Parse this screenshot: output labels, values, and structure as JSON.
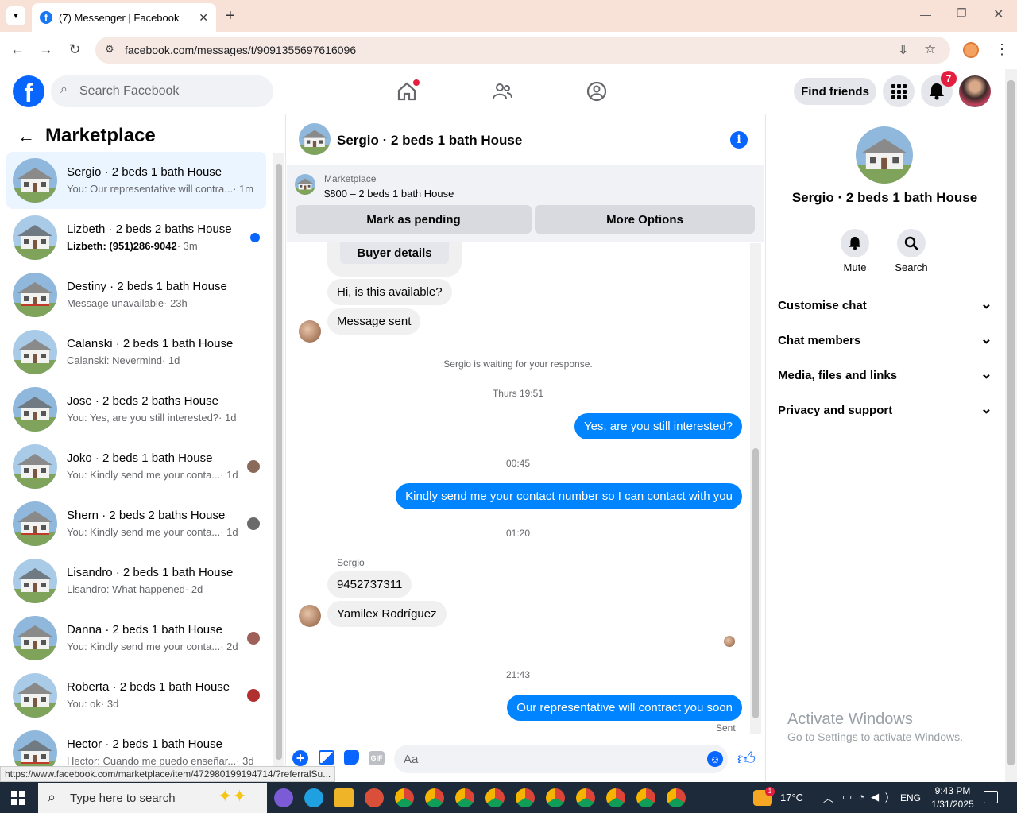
{
  "browser": {
    "tab_title": "(7) Messenger | Facebook",
    "url": "facebook.com/messages/t/9091355697616096"
  },
  "header": {
    "search_placeholder": "Search Facebook",
    "find_friends": "Find friends",
    "notif_count": "7"
  },
  "sidebar": {
    "title": "Marketplace",
    "conversations": [
      {
        "name": "Sergio · 2 beds 1 bath House",
        "preview": "You: Our representative will contra...",
        "time": "· 1m",
        "selected": true
      },
      {
        "name": "Lizbeth · 2 beds 2 baths House",
        "preview": "Lizbeth: (951)286-9042",
        "time": "· 3m",
        "unread": true
      },
      {
        "name": "Destiny · 2 beds 1 bath House",
        "preview": "Message unavailable",
        "time": "· 23h"
      },
      {
        "name": "Calanski · 2 beds 1 bath House",
        "preview": "Calanski: Nevermind",
        "time": "· 1d"
      },
      {
        "name": "Jose · 2 beds 2 baths House",
        "preview": "You: Yes, are you still interested?",
        "time": "· 1d"
      },
      {
        "name": "Joko · 2 beds 1 bath House",
        "preview": "You: Kindly send me your conta...",
        "time": "· 1d"
      },
      {
        "name": "Shern · 2 beds 2 baths House",
        "preview": "You: Kindly send me your conta...",
        "time": "· 1d"
      },
      {
        "name": "Lisandro · 2 beds 1 bath House",
        "preview": "Lisandro: What happened",
        "time": "· 2d"
      },
      {
        "name": "Danna · 2 beds 1 bath House",
        "preview": "You: Kindly send me your conta...",
        "time": "· 2d"
      },
      {
        "name": "Roberta · 2 beds 1 bath House",
        "preview": "You: ok",
        "time": "· 3d"
      },
      {
        "name": "Hector · 2 beds 1 bath House",
        "preview": "Hector: Cuando me puedo enseñar...",
        "time": "· 3d"
      }
    ]
  },
  "chat": {
    "title": "Sergio · 2 beds 1 bath House",
    "listing_label": "Marketplace",
    "listing_price": "$800 – 2 beds 1 bath House",
    "mark_pending": "Mark as pending",
    "more_options": "More Options",
    "buyer_details": "Buyer details",
    "msg_available": "Hi, is this available?",
    "msg_sent": "Message sent",
    "waiting": "Sergio is waiting for your response.",
    "ts1": "Thurs 19:51",
    "out1": "Yes, are you still interested?",
    "ts2": "00:45",
    "out2": "Kindly send me your contact number so I can contact with you",
    "ts3": "01:20",
    "sender": "Sergio",
    "in1": "9452737311",
    "in2": "Yamilex Rodríguez",
    "ts4": "21:43",
    "out3": "Our representative will contract you soon",
    "status": "Sent",
    "composer_placeholder": "Aa"
  },
  "details": {
    "title": "Sergio · 2 beds 1 bath House",
    "mute": "Mute",
    "search": "Search",
    "sections": [
      "Customise chat",
      "Chat members",
      "Media, files and links",
      "Privacy and support"
    ]
  },
  "watermark": {
    "line1": "Activate Windows",
    "line2": "Go to Settings to activate Windows."
  },
  "status_url": "https://www.facebook.com/marketplace/item/472980199194714/?referralSu...",
  "taskbar": {
    "search": "Type here to search",
    "temp": "17°C",
    "lang": "ENG",
    "time": "9:43 PM",
    "date": "1/31/2025",
    "weather_badge": "1"
  }
}
